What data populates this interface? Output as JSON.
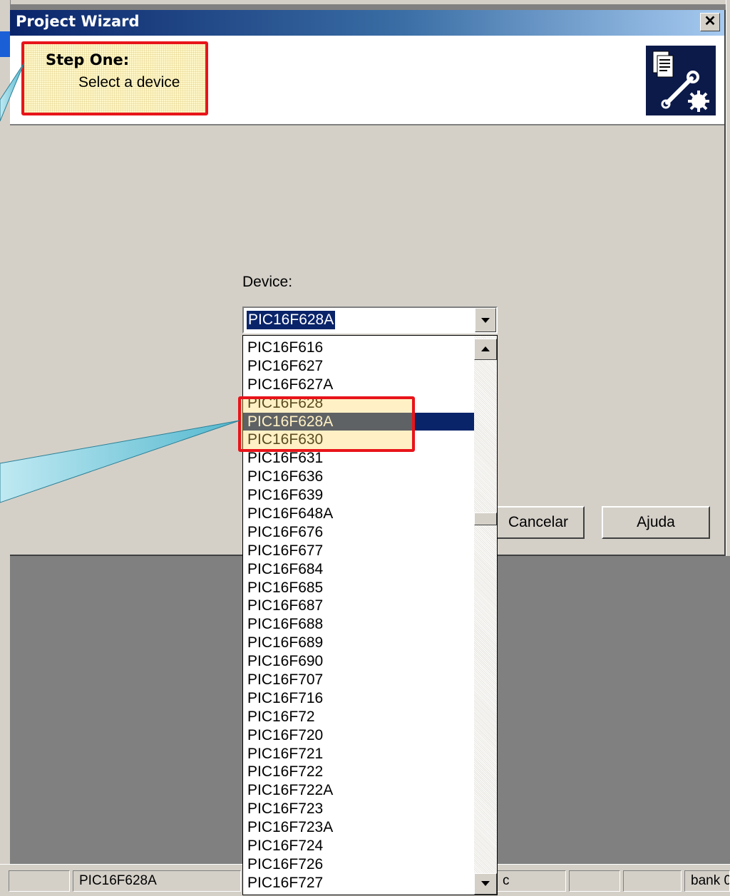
{
  "dialog": {
    "title": "Project Wizard",
    "close_glyph": "✕",
    "step_title": "Step One:",
    "step_subtitle": "Select a device",
    "device_label_html": "De<u>v</u>ice:",
    "device_label": "Device:",
    "selected_device": "PIC16F628A",
    "buttons": {
      "cancel": "Cancelar",
      "help": "Ajuda"
    }
  },
  "device_list": {
    "items": [
      "PIC16F616",
      "PIC16F627",
      "PIC16F627A",
      "PIC16F628",
      "PIC16F628A",
      "PIC16F630",
      "PIC16F631",
      "PIC16F636",
      "PIC16F639",
      "PIC16F648A",
      "PIC16F676",
      "PIC16F677",
      "PIC16F684",
      "PIC16F685",
      "PIC16F687",
      "PIC16F688",
      "PIC16F689",
      "PIC16F690",
      "PIC16F707",
      "PIC16F716",
      "PIC16F72",
      "PIC16F720",
      "PIC16F721",
      "PIC16F722",
      "PIC16F722A",
      "PIC16F723",
      "PIC16F723A",
      "PIC16F724",
      "PIC16F726",
      "PIC16F727"
    ],
    "selected_index": 4
  },
  "statusbar": {
    "device": "PIC16F628A",
    "cell_c": "c",
    "bank": "bank 0"
  },
  "colors": {
    "annotation_red": "#e8141a",
    "selection_blue": "#0a246a",
    "title_gradient_start": "#0a246a"
  },
  "icons": {
    "close": "close-icon",
    "wizard": "wizard-tools-icon",
    "combo_arrow": "chevron-down-icon"
  }
}
